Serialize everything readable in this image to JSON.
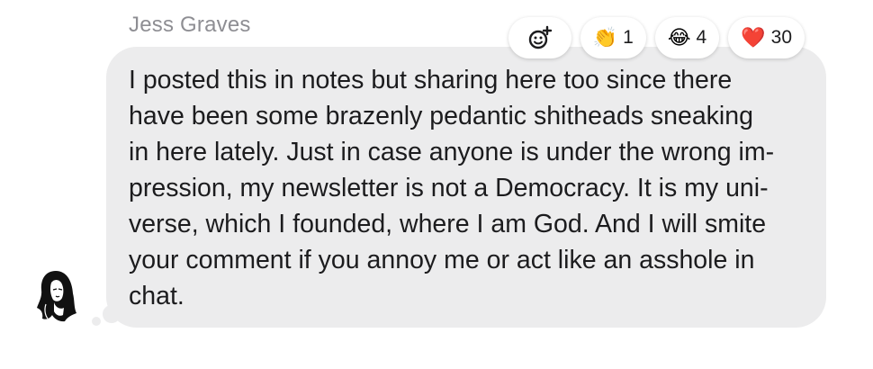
{
  "author": "Jess Graves",
  "message_lines": [
    "I posted this in notes but sharing here too since there",
    "have been some brazenly pedantic shitheads sneaking",
    "in here lately. Just in case anyone is under the wrong im-",
    "pression, my newsletter is not a Democracy. It is my uni-",
    "verse, which I founded, where I am God. And I will smite",
    "your comment if you annoy me or act like an asshole in",
    "chat."
  ],
  "reactions": [
    {
      "icon": "clapping-hands",
      "emoji": "👏",
      "count": "1"
    },
    {
      "icon": "tears-of-joy",
      "emoji": "😂",
      "count": "4"
    },
    {
      "icon": "red-heart",
      "emoji": "❤️",
      "count": "30"
    }
  ],
  "colors": {
    "bubble": "#ececed",
    "author": "#8e8e93",
    "text": "#1c1c1e",
    "heart": "#e0245e"
  }
}
